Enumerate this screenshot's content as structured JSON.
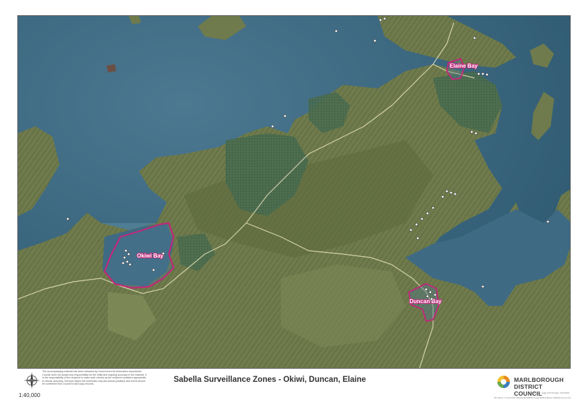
{
  "title": "Sabella Surveillance Zones - Okiwi, Duncan, Elaine",
  "scale": "1:40,000",
  "disclaimer": "The accompanying material has been released by Council from its information repositories Council does not accept any responsibility for the initial and ongoing accuracy in the material. It is the responsibility of the recipient to make such checks as the recipient considers appropriate to ensure accuracy. Services layers are schematic only and actual positions and levels should be confirmed from Council's hard copy records.",
  "organization": {
    "line1": "MARLBOROUGH",
    "line2": "DISTRICT COUNCIL"
  },
  "printed_by": "Printed by: jsq@ 4/27/19 Date: 4/07/2019",
  "file_path": "File Name: C:\\Users\\31 Shutting\\GIS\\MXD Projects\\Pilot Marine Sabella Comp.mxd",
  "zones": [
    {
      "name": "Okiwi Bay",
      "label": "Okiwi Bay"
    },
    {
      "name": "Duncan Bay",
      "label": "Duncan Bay"
    },
    {
      "name": "Elaine Bay",
      "label": "Elaine Bay"
    }
  ],
  "colors": {
    "water": "#3f6a84",
    "land": "#6e7a4a",
    "forest": "#46684c",
    "zone_outline": "#c0287a",
    "road": "#e8e2bc"
  },
  "icons": [
    "compass-rose-icon",
    "council-logo-icon",
    "mooring-point-icon"
  ]
}
